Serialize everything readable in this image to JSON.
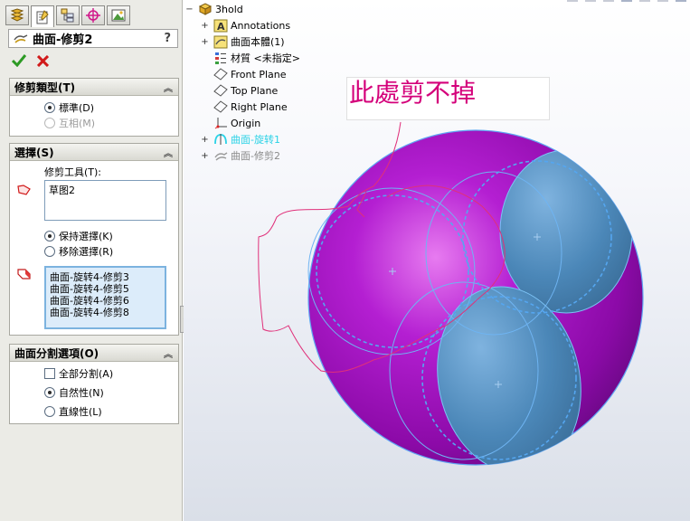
{
  "property_manager": {
    "title": "曲面-修剪2",
    "help": "?",
    "trim_type": {
      "header": "修剪類型(T)",
      "standard": "標準(D)",
      "mutual": "互相(M)"
    },
    "selection": {
      "header": "選擇(S)",
      "tool_label": "修剪工具(T):",
      "tool_value": "草图2",
      "keep": "保持選擇(K)",
      "remove": "移除選擇(R)",
      "items": [
        "曲面-旋转4-修剪3",
        "曲面-旋转4-修剪5",
        "曲面-旋转4-修剪6",
        "曲面-旋转4-修剪8"
      ]
    },
    "split": {
      "header": "曲面分割選項(O)",
      "split_all": "全部分割(A)",
      "natural": "自然性(N)",
      "linear": "直線性(L)"
    }
  },
  "tree": {
    "root": "3hold",
    "items": [
      "Annotations",
      "曲面本體(1)",
      "材質 <未指定>",
      "Front Plane",
      "Top Plane",
      "Right Plane",
      "Origin",
      "曲面-旋转1",
      "曲面-修剪2"
    ]
  },
  "annotation": "此處剪不掉",
  "colors": {
    "sphere": "#a60fc9",
    "patch": "#4a85b6",
    "sketch": "#e0307a",
    "highlight": "#2ad2e6"
  }
}
